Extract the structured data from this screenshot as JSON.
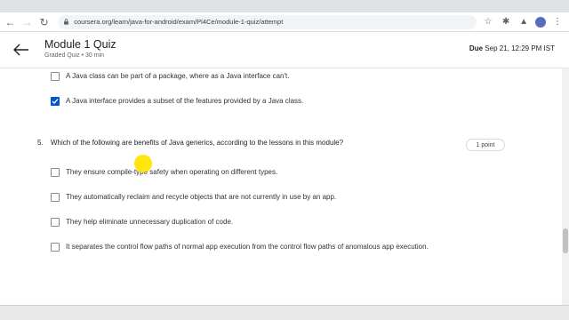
{
  "browser": {
    "url": "coursera.org/learn/java-for-android/exam/Pl4Ce/module-1-quiz/attempt"
  },
  "header": {
    "title": "Module 1 Quiz",
    "subtitle": "Graded Quiz • 30 min",
    "due_label": "Due",
    "due_value": "Sep 21, 12:29 PM IST"
  },
  "previous_question": {
    "options": [
      {
        "text": "A Java class can be part of a package, where as a Java interface can't.",
        "checked": false
      },
      {
        "text": "A Java interface provides a subset of the features provided by a Java class.",
        "checked": true
      }
    ]
  },
  "question": {
    "number": "5.",
    "text": "Which of the following are benefits of Java generics, according to the lessons in this module?",
    "points": "1 point",
    "options": [
      {
        "text": "They ensure compile-type safety when operating on different types.",
        "checked": false
      },
      {
        "text": "They automatically reclaim and recycle objects that are not currently in use by an app.",
        "checked": false
      },
      {
        "text": "They help eliminate unnecessary duplication of code.",
        "checked": false
      },
      {
        "text": "It separates the control flow paths of normal app execution from the control flow paths of anomalous app execution.",
        "checked": false
      }
    ]
  },
  "colors": {
    "accent": "#0056d2",
    "cursor_highlight": "#ffe600"
  }
}
